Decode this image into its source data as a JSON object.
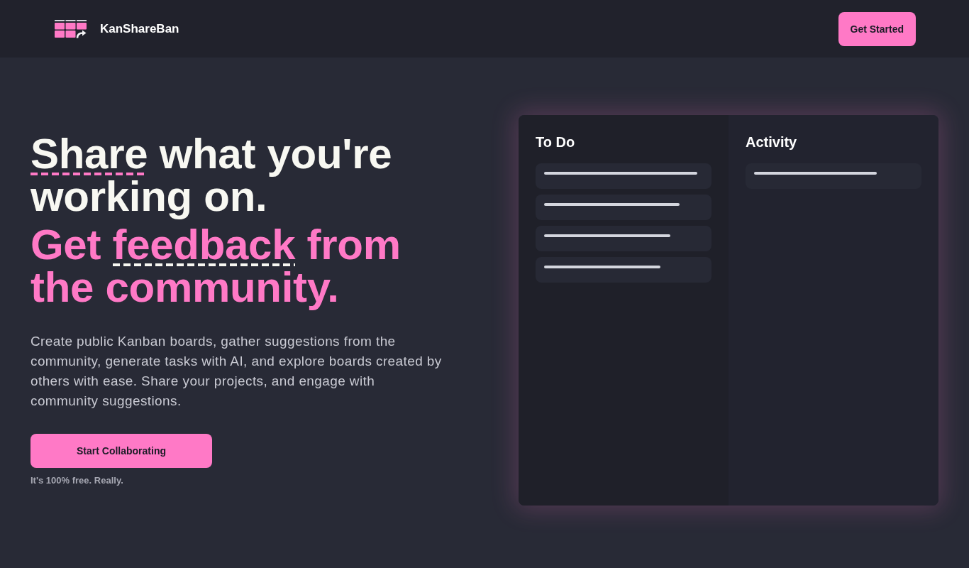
{
  "header": {
    "brand": "KanShareBan",
    "cta": "Get Started"
  },
  "hero": {
    "headline": [
      {
        "text": "Share",
        "underlined": true
      },
      {
        "text": " what you're working on.",
        "underlined": false
      }
    ],
    "tagline": [
      {
        "text": "Get ",
        "underlined": false
      },
      {
        "text": "feedback",
        "underlined": true
      },
      {
        "text": " from the community.",
        "underlined": false
      }
    ],
    "description": "Create public Kanban boards, gather suggestions from the community, generate tasks with AI, and explore boards created by others with ease. Share your projects, and engage with community suggestions.",
    "cta": "Start Collaborating",
    "note": "It's 100% free. Really."
  },
  "board": {
    "columns": [
      {
        "title": "To Do",
        "cards": [
          {
            "kind": "placeholder"
          },
          {
            "kind": "placeholder"
          },
          {
            "kind": "placeholder"
          },
          {
            "kind": "placeholder"
          }
        ]
      },
      {
        "title": "Activity",
        "cards": [
          {
            "kind": "placeholder"
          }
        ]
      }
    ]
  }
}
